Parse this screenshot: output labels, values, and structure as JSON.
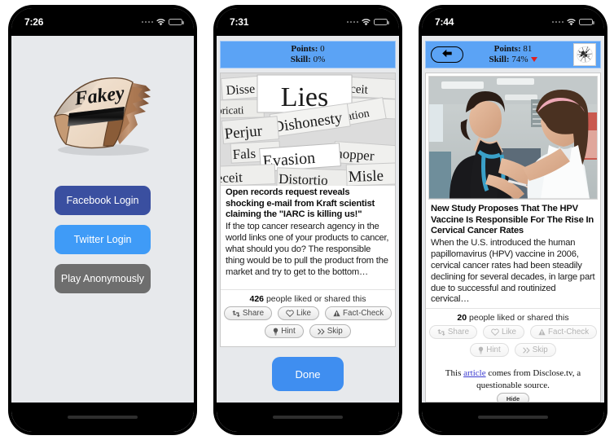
{
  "app": {
    "name": "Fakey",
    "logo_text": "Fakey"
  },
  "screens": [
    {
      "id": "login",
      "status": {
        "time": "7:26",
        "signal_icon": "signal-dots-icon",
        "wifi_icon": "wifi-icon",
        "battery_icon": "battery-low-icon"
      },
      "logo": {
        "alt": "fakey-newspaper-logo",
        "word": "Fakey"
      },
      "buttons": [
        {
          "id": "facebook-login",
          "label": "Facebook Login",
          "color": "#3a4fa0"
        },
        {
          "id": "twitter-login",
          "label": "Twitter Login",
          "color": "#3f9bf7"
        },
        {
          "id": "play-anonymously",
          "label": "Play Anonymously",
          "color": "#6e6e6e"
        }
      ]
    },
    {
      "id": "feed-start",
      "status": {
        "time": "7:31",
        "signal_icon": "signal-dots-icon",
        "wifi_icon": "wifi-icon",
        "battery_icon": "battery-low-icon"
      },
      "score": {
        "points_label": "Points:",
        "points_value": "0",
        "skill_label": "Skill:",
        "skill_value": "0%",
        "show_back": false,
        "show_avatar": false,
        "show_trend": false
      },
      "article": {
        "image_alt": "lies-words-collage-image",
        "image_words": [
          "Lies",
          "Dissemble",
          "Fabrication",
          "Deceit",
          "Dishonesty",
          "Perjury",
          "False",
          "Evasion",
          "Distortion",
          "Whopper",
          "Misleading"
        ],
        "headline": "Open records request reveals shocking e-mail from Kraft scientist claiming the \"IARC is killing us!\"",
        "summary": "If the top cancer research agency in the world links one of your products to cancer, what should you do? The responsible thing would be to pull the product from the market and try to get to the bottom…",
        "likes_count": "426",
        "likes_text": "people liked or shared this"
      },
      "actions": [
        {
          "id": "share",
          "label": "Share",
          "icon": "retweet-icon",
          "disabled": false
        },
        {
          "id": "like",
          "label": "Like",
          "icon": "heart-icon",
          "disabled": false
        },
        {
          "id": "fact-check",
          "label": "Fact-Check",
          "icon": "warning-triangle-icon",
          "disabled": false
        },
        {
          "id": "hint",
          "label": "Hint",
          "icon": "lightbulb-icon",
          "disabled": false
        },
        {
          "id": "skip",
          "label": "Skip",
          "icon": "double-chevron-right-icon",
          "disabled": false
        }
      ],
      "footer": {
        "done_label": "Done"
      }
    },
    {
      "id": "feed-result",
      "status": {
        "time": "7:44",
        "signal_icon": "signal-dots-icon",
        "wifi_icon": "wifi-icon",
        "battery_icon": "battery-low-icon"
      },
      "score": {
        "points_label": "Points:",
        "points_value": "81",
        "skill_label": "Skill:",
        "skill_value": "74%",
        "show_back": true,
        "back_icon": "arrow-left-icon",
        "show_avatar": true,
        "avatar_alt": "user-identicon-avatar",
        "show_trend": true,
        "trend_icon": "triangle-down-icon",
        "trend_color": "#e02020"
      },
      "article": {
        "image_alt": "nurse-vaccinating-girl-photo",
        "headline": "New Study Proposes That The HPV Vaccine Is Responsible For The Rise In Cervical Cancer Rates",
        "summary": "When the U.S. introduced the human papillomavirus (HPV) vaccine in 2006, cervical cancer rates had been steadily declining for several decades, in large part due to successful and routinized cervical…",
        "likes_count": "20",
        "likes_text": "people liked or shared this"
      },
      "actions": [
        {
          "id": "share",
          "label": "Share",
          "icon": "retweet-icon",
          "disabled": true
        },
        {
          "id": "like",
          "label": "Like",
          "icon": "heart-icon",
          "disabled": true
        },
        {
          "id": "fact-check",
          "label": "Fact-Check",
          "icon": "warning-triangle-icon",
          "disabled": true
        },
        {
          "id": "hint",
          "label": "Hint",
          "icon": "lightbulb-icon",
          "disabled": true
        },
        {
          "id": "skip",
          "label": "Skip",
          "icon": "double-chevron-right-icon",
          "disabled": true
        }
      ],
      "disclosure": {
        "prefix": "This ",
        "link": "article",
        "suffix": " comes from Disclose.tv, a questionable source.",
        "hide_label": "Hide"
      }
    }
  ]
}
